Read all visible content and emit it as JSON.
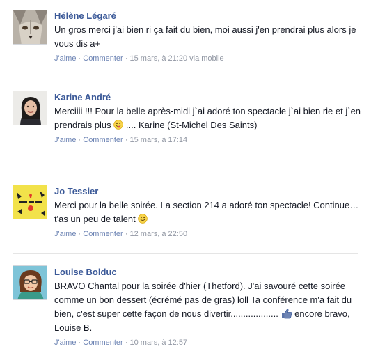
{
  "comments": [
    {
      "author": "Hélène Légaré",
      "text": "Un gros merci j'ai bien ri ça fait du bien, moi aussi j'en prendrai plus alors je vous dis a+",
      "like": "J'aime",
      "reply": "Commenter",
      "timestamp": "15 mars, à 21:20",
      "via": "via mobile"
    },
    {
      "author": "Karine André",
      "text_before": "Merciiii !!! Pour la belle après-midi j`ai adoré ton spectacle j`ai bien rie et j`en prendrais plus",
      "emoticon": "wink-tongue-icon",
      "text_after": ".... Karine (St-Michel Des Saints)",
      "like": "J'aime",
      "reply": "Commenter",
      "timestamp": "15 mars, à 17:14"
    },
    {
      "author": "Jo Tessier",
      "text_before": "Merci pour la belle soirée. La section 214 a adoré ton spectacle! Continue… t'as un peu de talent",
      "emoticon": "smile-icon",
      "like": "J'aime",
      "reply": "Commenter",
      "timestamp": "12 mars, à 22:50"
    },
    {
      "author": "Louise Bolduc",
      "text_before": "BRAVO Chantal pour la soirée d'hier (Thetford). J'ai savouré cette soirée comme un bon dessert (écrémé pas de gras) loll Ta conférence m'a fait du bien, c'est super cette façon de nous divertir...................",
      "emoticon": "thumbs-up-icon",
      "text_after": "encore bravo, Louise B.",
      "like": "J'aime",
      "reply": "Commenter",
      "timestamp": "10 mars, à 12:57"
    }
  ],
  "colors": {
    "author_link": "#3b5998",
    "action_link": "#6d84b4",
    "meta_text": "#9197a3",
    "divider": "#e5e5e5"
  }
}
